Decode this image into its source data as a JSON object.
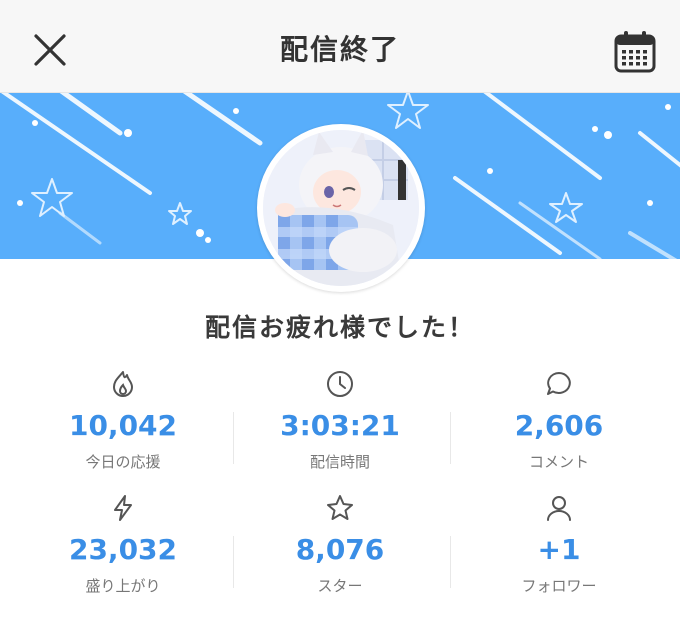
{
  "header": {
    "title": "配信終了",
    "close_icon": "close-icon",
    "calendar_icon": "calendar-icon"
  },
  "colors": {
    "banner": "#58aefb",
    "accent_value": "#3a8ee6"
  },
  "message": "配信お疲れ様でした！",
  "stats": [
    {
      "icon": "flame-icon",
      "value": "10,042",
      "label": "今日の応援"
    },
    {
      "icon": "clock-icon",
      "value": "3:03:21",
      "label": "配信時間"
    },
    {
      "icon": "comment-icon",
      "value": "2,606",
      "label": "コメント"
    },
    {
      "icon": "lightning-icon",
      "value": "23,032",
      "label": "盛り上がり"
    },
    {
      "icon": "star-icon",
      "value": "8,076",
      "label": "スター"
    },
    {
      "icon": "person-icon",
      "value": "+1",
      "label": "フォロワー"
    }
  ]
}
